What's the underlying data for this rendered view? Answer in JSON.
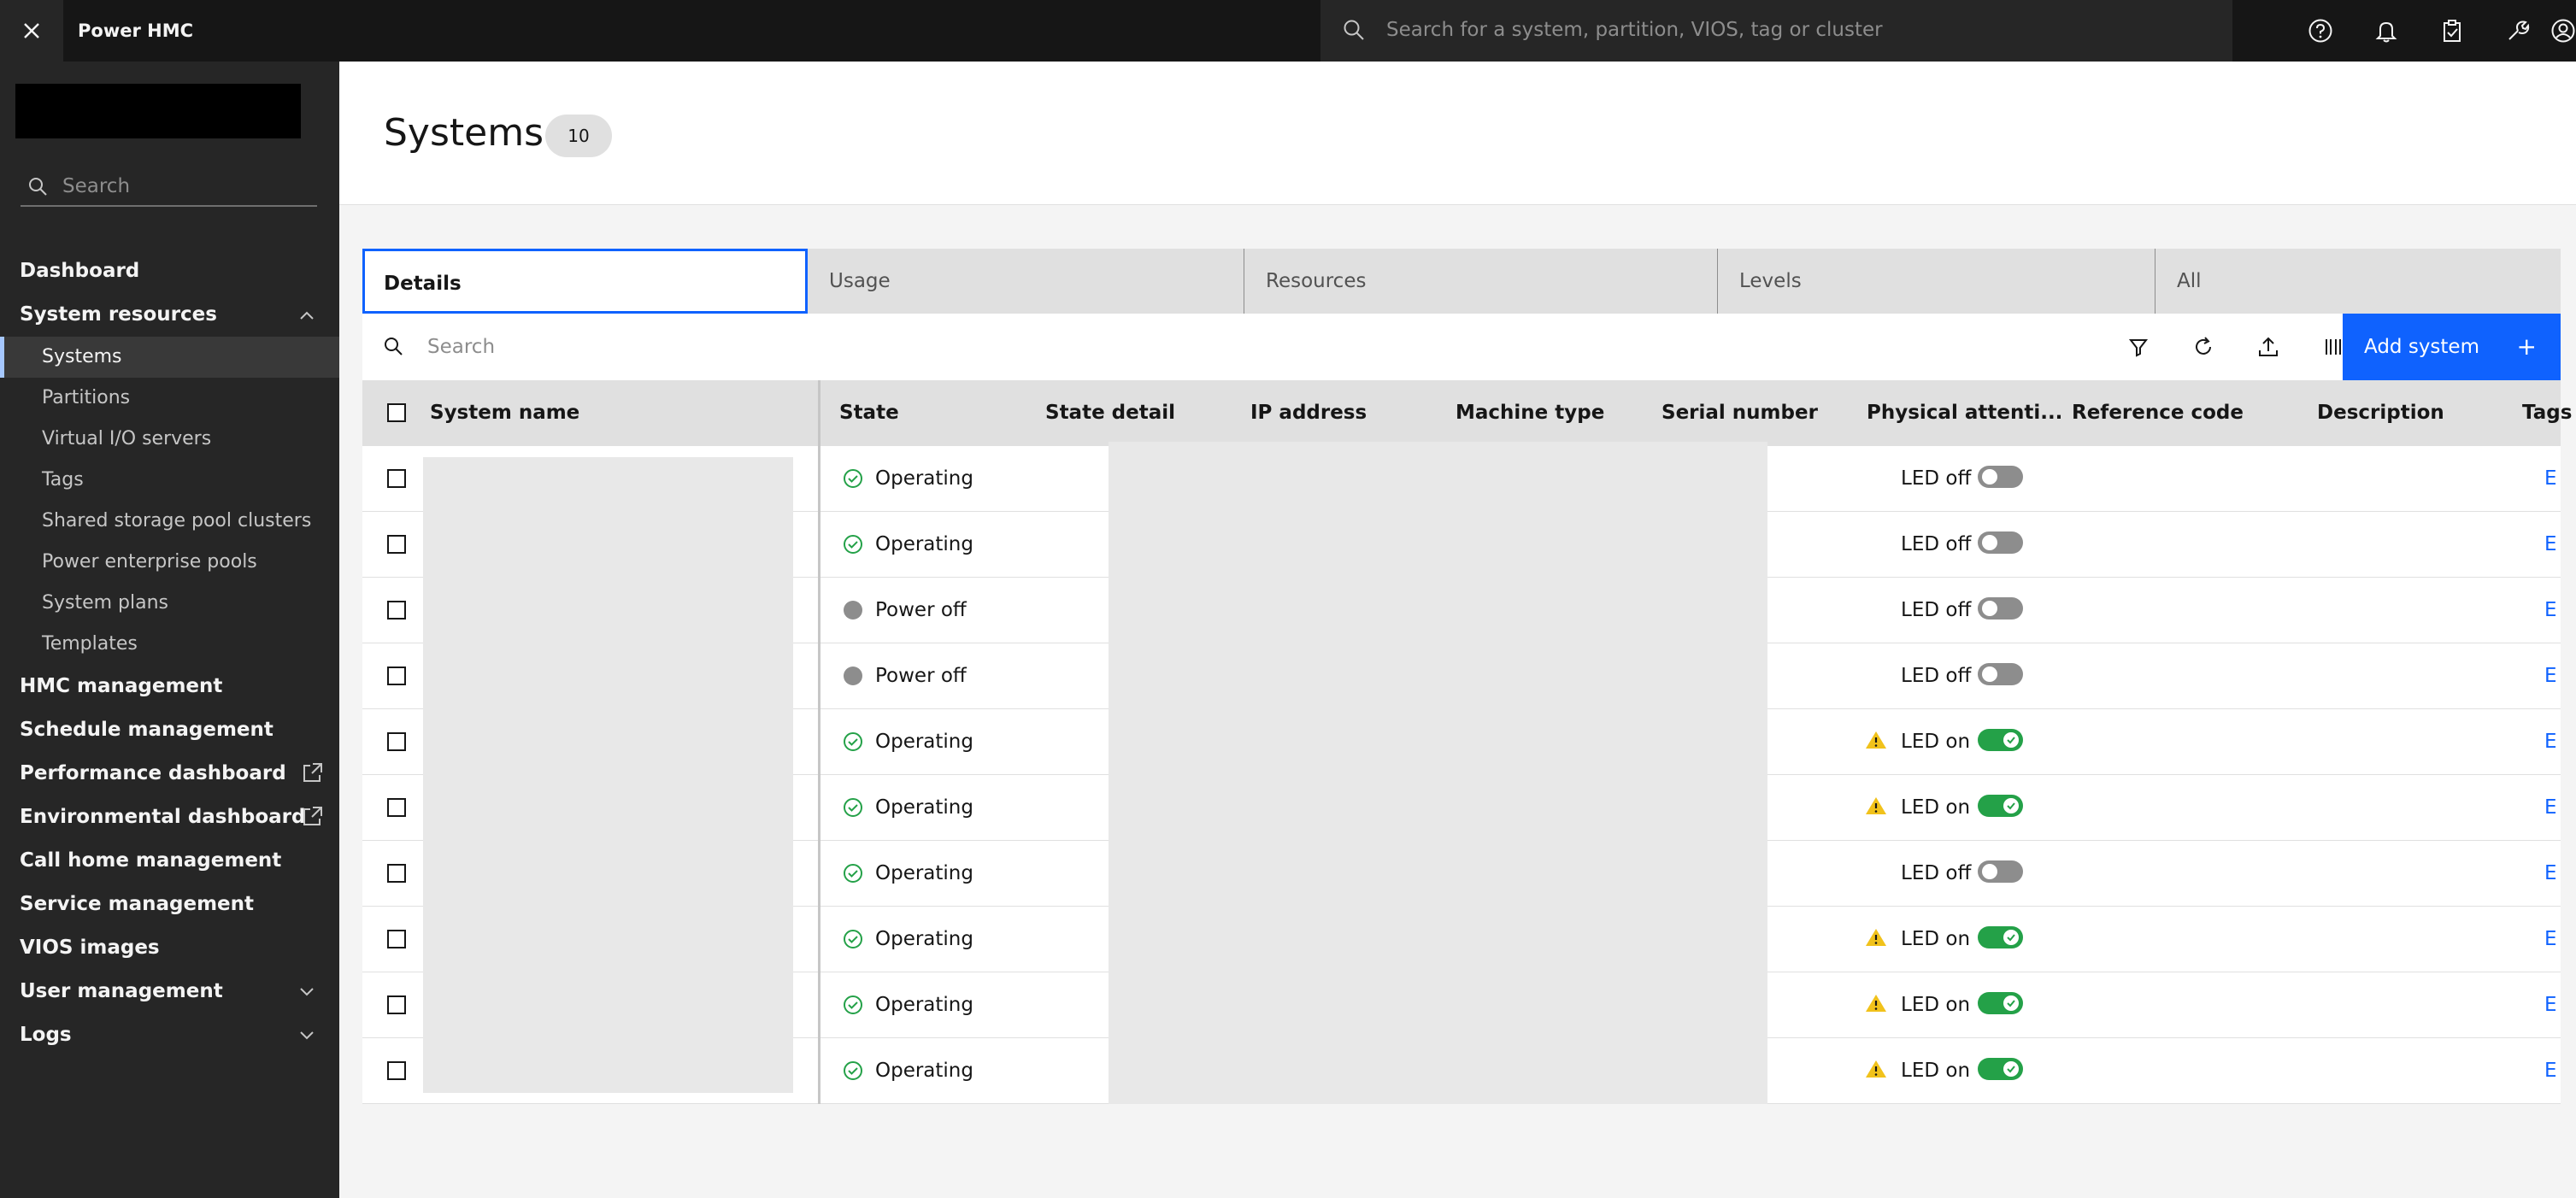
{
  "header": {
    "app_title": "Power HMC",
    "search_placeholder": "Search for a system, partition, VIOS, tag or cluster",
    "icons": [
      "help-icon",
      "notification-icon",
      "clipboard-icon",
      "wrench-icon",
      "user-icon"
    ]
  },
  "sidebar": {
    "search_placeholder": "Search",
    "items": [
      {
        "label": "Dashboard"
      },
      {
        "label": "System resources",
        "expanded": true,
        "children": [
          {
            "label": "Systems",
            "active": true
          },
          {
            "label": "Partitions"
          },
          {
            "label": "Virtual I/O servers"
          },
          {
            "label": "Tags"
          },
          {
            "label": "Shared storage pool clusters"
          },
          {
            "label": "Power enterprise pools"
          },
          {
            "label": "System plans"
          },
          {
            "label": "Templates"
          }
        ]
      },
      {
        "label": "HMC management"
      },
      {
        "label": "Schedule management"
      },
      {
        "label": "Performance dashboard",
        "external": true
      },
      {
        "label": "Environmental dashboard",
        "external": true
      },
      {
        "label": "Call home management"
      },
      {
        "label": "Service management"
      },
      {
        "label": "VIOS images"
      },
      {
        "label": "User management",
        "expandable": true
      },
      {
        "label": "Logs",
        "expandable": true
      }
    ]
  },
  "page": {
    "title": "Systems",
    "count": "10"
  },
  "tabs": [
    {
      "label": "Details",
      "active": true
    },
    {
      "label": "Usage"
    },
    {
      "label": "Resources"
    },
    {
      "label": "Levels"
    },
    {
      "label": "All"
    }
  ],
  "toolbar": {
    "search_placeholder": "Search",
    "add_label": "Add system",
    "add_plus": "+",
    "icons": [
      "filter-icon",
      "refresh-icon",
      "export-icon",
      "columns-icon"
    ]
  },
  "table": {
    "columns": [
      "System name",
      "State",
      "State detail",
      "IP address",
      "Machine type",
      "Serial number",
      "Physical attenti...",
      "Reference code",
      "Description",
      "Tags"
    ],
    "rows": [
      {
        "state": "Operating",
        "led": "LED off",
        "led_on": false,
        "warning": false,
        "tag": "E"
      },
      {
        "state": "Operating",
        "led": "LED off",
        "led_on": false,
        "warning": false,
        "tag": "E"
      },
      {
        "state": "Power off",
        "led": "LED off",
        "led_on": false,
        "warning": false,
        "tag": "E"
      },
      {
        "state": "Power off",
        "led": "LED off",
        "led_on": false,
        "warning": false,
        "tag": "E"
      },
      {
        "state": "Operating",
        "led": "LED on",
        "led_on": true,
        "warning": true,
        "tag": "E"
      },
      {
        "state": "Operating",
        "led": "LED on",
        "led_on": true,
        "warning": true,
        "tag": "E"
      },
      {
        "state": "Operating",
        "led": "LED off",
        "led_on": false,
        "warning": false,
        "tag": "E"
      },
      {
        "state": "Operating",
        "led": "LED on",
        "led_on": true,
        "warning": true,
        "tag": "E"
      },
      {
        "state": "Operating",
        "led": "LED on",
        "led_on": true,
        "warning": true,
        "tag": "E"
      },
      {
        "state": "Operating",
        "led": "LED on",
        "led_on": true,
        "warning": true,
        "tag": "E"
      }
    ]
  },
  "colors": {
    "accent": "#0f62fe",
    "operating": "#24a148",
    "power_off": "#8d8d8d",
    "warning": "#f1c21b"
  }
}
